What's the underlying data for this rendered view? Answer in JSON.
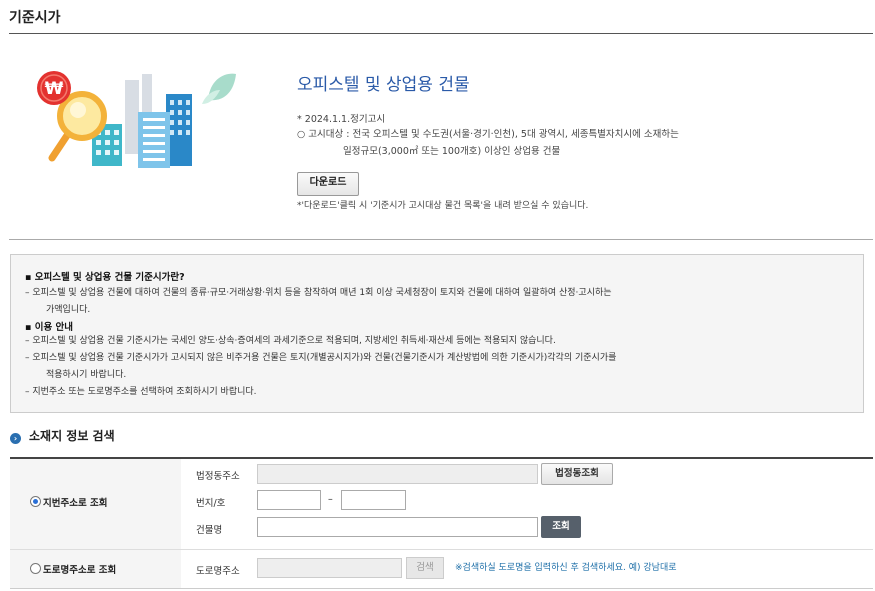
{
  "page": {
    "title": "기준시가"
  },
  "product": {
    "title": "오피스텔 및 상업용 건물",
    "notice_date": "* 2024.1.1.정기고시",
    "target_line1": "○ 고시대상 : 전국 오피스텔 및 수도권(서울·경기·인천), 5대 광역시, 세종특별자치시에 소재하는",
    "target_line2": "일정규모(3,000㎡ 또는 100개호) 이상인 상업용 건물",
    "download_label": "다운로드",
    "download_note": "*'다운로드'클릭 시 '기준시가 고시대상 물건 목록'을 내려 받으실 수 있습니다."
  },
  "info": {
    "what_title": "▪ 오피스텔 및 상업용 건물 기준시가란?",
    "what_line1": "– 오피스텔 및 상업용 건물에 대하여 건물의 종류·규모·거래상황·위치 등을 참작하여 매년 1회 이상 국세청장이 토지와 건물에 대하여 일괄하여 산정·고시하는",
    "what_line2": "가액입니다.",
    "guide_title": "▪ 이용 안내",
    "guide_1": "– 오피스텔 및 상업용 건물 기준시가는 국세인 양도·상속·증여세의 과세기준으로 적용되며, 지방세인 취득세·재산세 등에는 적용되지 않습니다.",
    "guide_2a": "– 오피스텔 및 상업용 건물 기준시가가 고시되지 않은 비주거용 건물은 토지(개별공시지가)와 건물(건물기준시가 계산방법에 의한 기준시가)각각의 기준시가를",
    "guide_2b": "적용하시기 바랍니다.",
    "guide_3": "– 지번주소 또는 도로명주소를 선택하여 조회하시기 바랍니다."
  },
  "search": {
    "section_title": "소재지 정보 검색",
    "jibun": {
      "radio_label": "지번주소로 조회",
      "selected": true,
      "dong_label": "법정동주소",
      "dong_button": "법정동조회",
      "bunji_label": "번지/호",
      "dash": "–",
      "building_label": "건물명",
      "search_button": "조회"
    },
    "road": {
      "radio_label": "도로명주소로 조회",
      "selected": false,
      "road_label": "도로명주소",
      "search_button": "검색",
      "hint": "※검색하실 도로명을 입력하신 후 검색하세요. 예) 강남대로"
    }
  },
  "colors": {
    "accent": "#2a5aa8",
    "link": "#1e6fa8",
    "dark_button": "#56606b"
  },
  "icons": [
    "won-coin-icon",
    "magnifier-icon",
    "building-illustration",
    "leaf-icon",
    "section-bullet-icon"
  ]
}
